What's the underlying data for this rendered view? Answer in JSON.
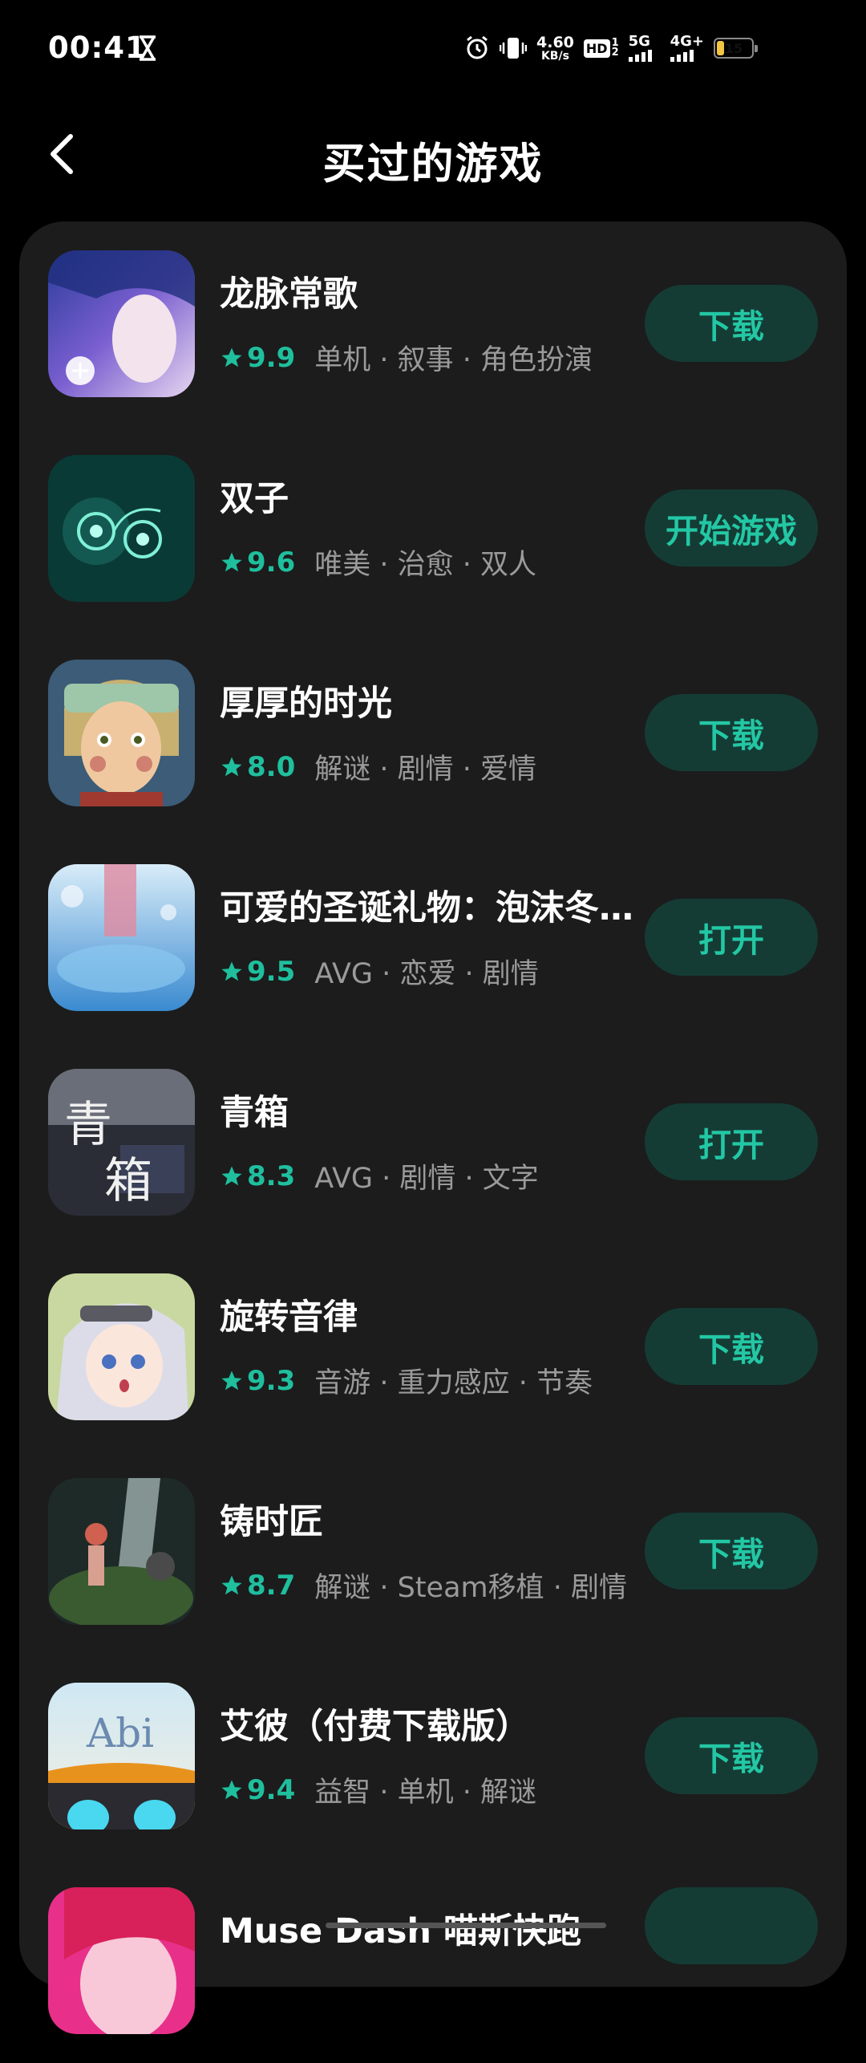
{
  "status_bar": {
    "time": "00:41",
    "net_speed_value": "4.60",
    "net_speed_unit": "KB/s",
    "hd_label": "HD",
    "network_1": "5G",
    "network_2": "4G+",
    "battery_level": "15",
    "battery_color": "#f2c542"
  },
  "header": {
    "title": "买过的游戏",
    "back_icon": "chevron-left-icon"
  },
  "accent_color": "#1fbf9e",
  "games": [
    {
      "name": "龙脉常歌",
      "rating": "9.9",
      "tags": "单机 · 叙事 · 角色扮演",
      "action": "下载"
    },
    {
      "name": "双子",
      "rating": "9.6",
      "tags": "唯美 · 治愈 · 双人",
      "action": "开始游戏"
    },
    {
      "name": "厚厚的时光",
      "rating": "8.0",
      "tags": "解谜 · 剧情 · 爱情",
      "action": "下载"
    },
    {
      "name": "可爱的圣诞礼物：泡沫冬...",
      "rating": "9.5",
      "tags": "AVG · 恋爱 · 剧情",
      "action": "打开"
    },
    {
      "name": "青箱",
      "rating": "8.3",
      "tags": "AVG · 剧情 · 文字",
      "action": "打开"
    },
    {
      "name": "旋转音律",
      "rating": "9.3",
      "tags": "音游 · 重力感应 · 节奏",
      "action": "下载"
    },
    {
      "name": "铸时匠",
      "rating": "8.7",
      "tags": "解谜 · Steam移植 · 剧情",
      "action": "下载"
    },
    {
      "name": "艾彼（付费下载版）",
      "rating": "9.4",
      "tags": "益智 · 单机 · 解谜",
      "action": "下载"
    },
    {
      "name": "Muse Dash 喵斯快跑",
      "rating": "",
      "tags": "",
      "action": ""
    }
  ],
  "thumb_text": {
    "qingxiang_1": "青",
    "qingxiang_2": "箱",
    "abi": "Abi"
  }
}
